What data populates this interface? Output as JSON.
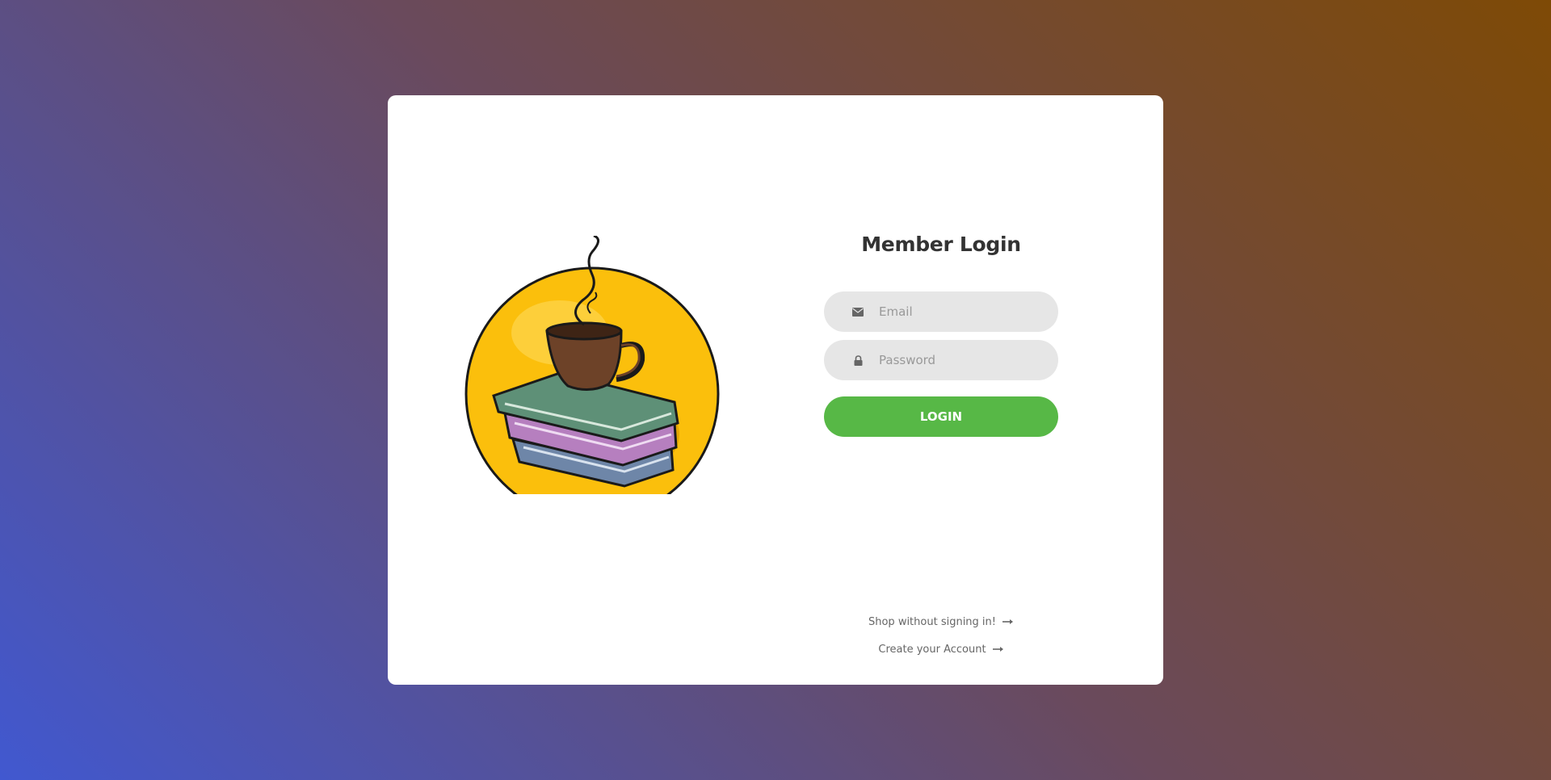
{
  "login": {
    "title": "Member Login",
    "email": {
      "placeholder": "Email",
      "value": "",
      "icon": "envelope-icon"
    },
    "password": {
      "placeholder": "Password",
      "value": "",
      "icon": "lock-icon"
    },
    "submit_label": "LOGIN"
  },
  "links": {
    "shop_label": "Shop without signing in!",
    "create_label": "Create your Account",
    "arrow_icon": "long-arrow-right-icon"
  },
  "logo": {
    "icon": "coffee-cup-on-books-logo"
  },
  "colors": {
    "accent": "#57b846",
    "field_bg": "#e6e6e6",
    "gradient_start": "#4158d0",
    "gradient_end": "#7e4a06"
  }
}
